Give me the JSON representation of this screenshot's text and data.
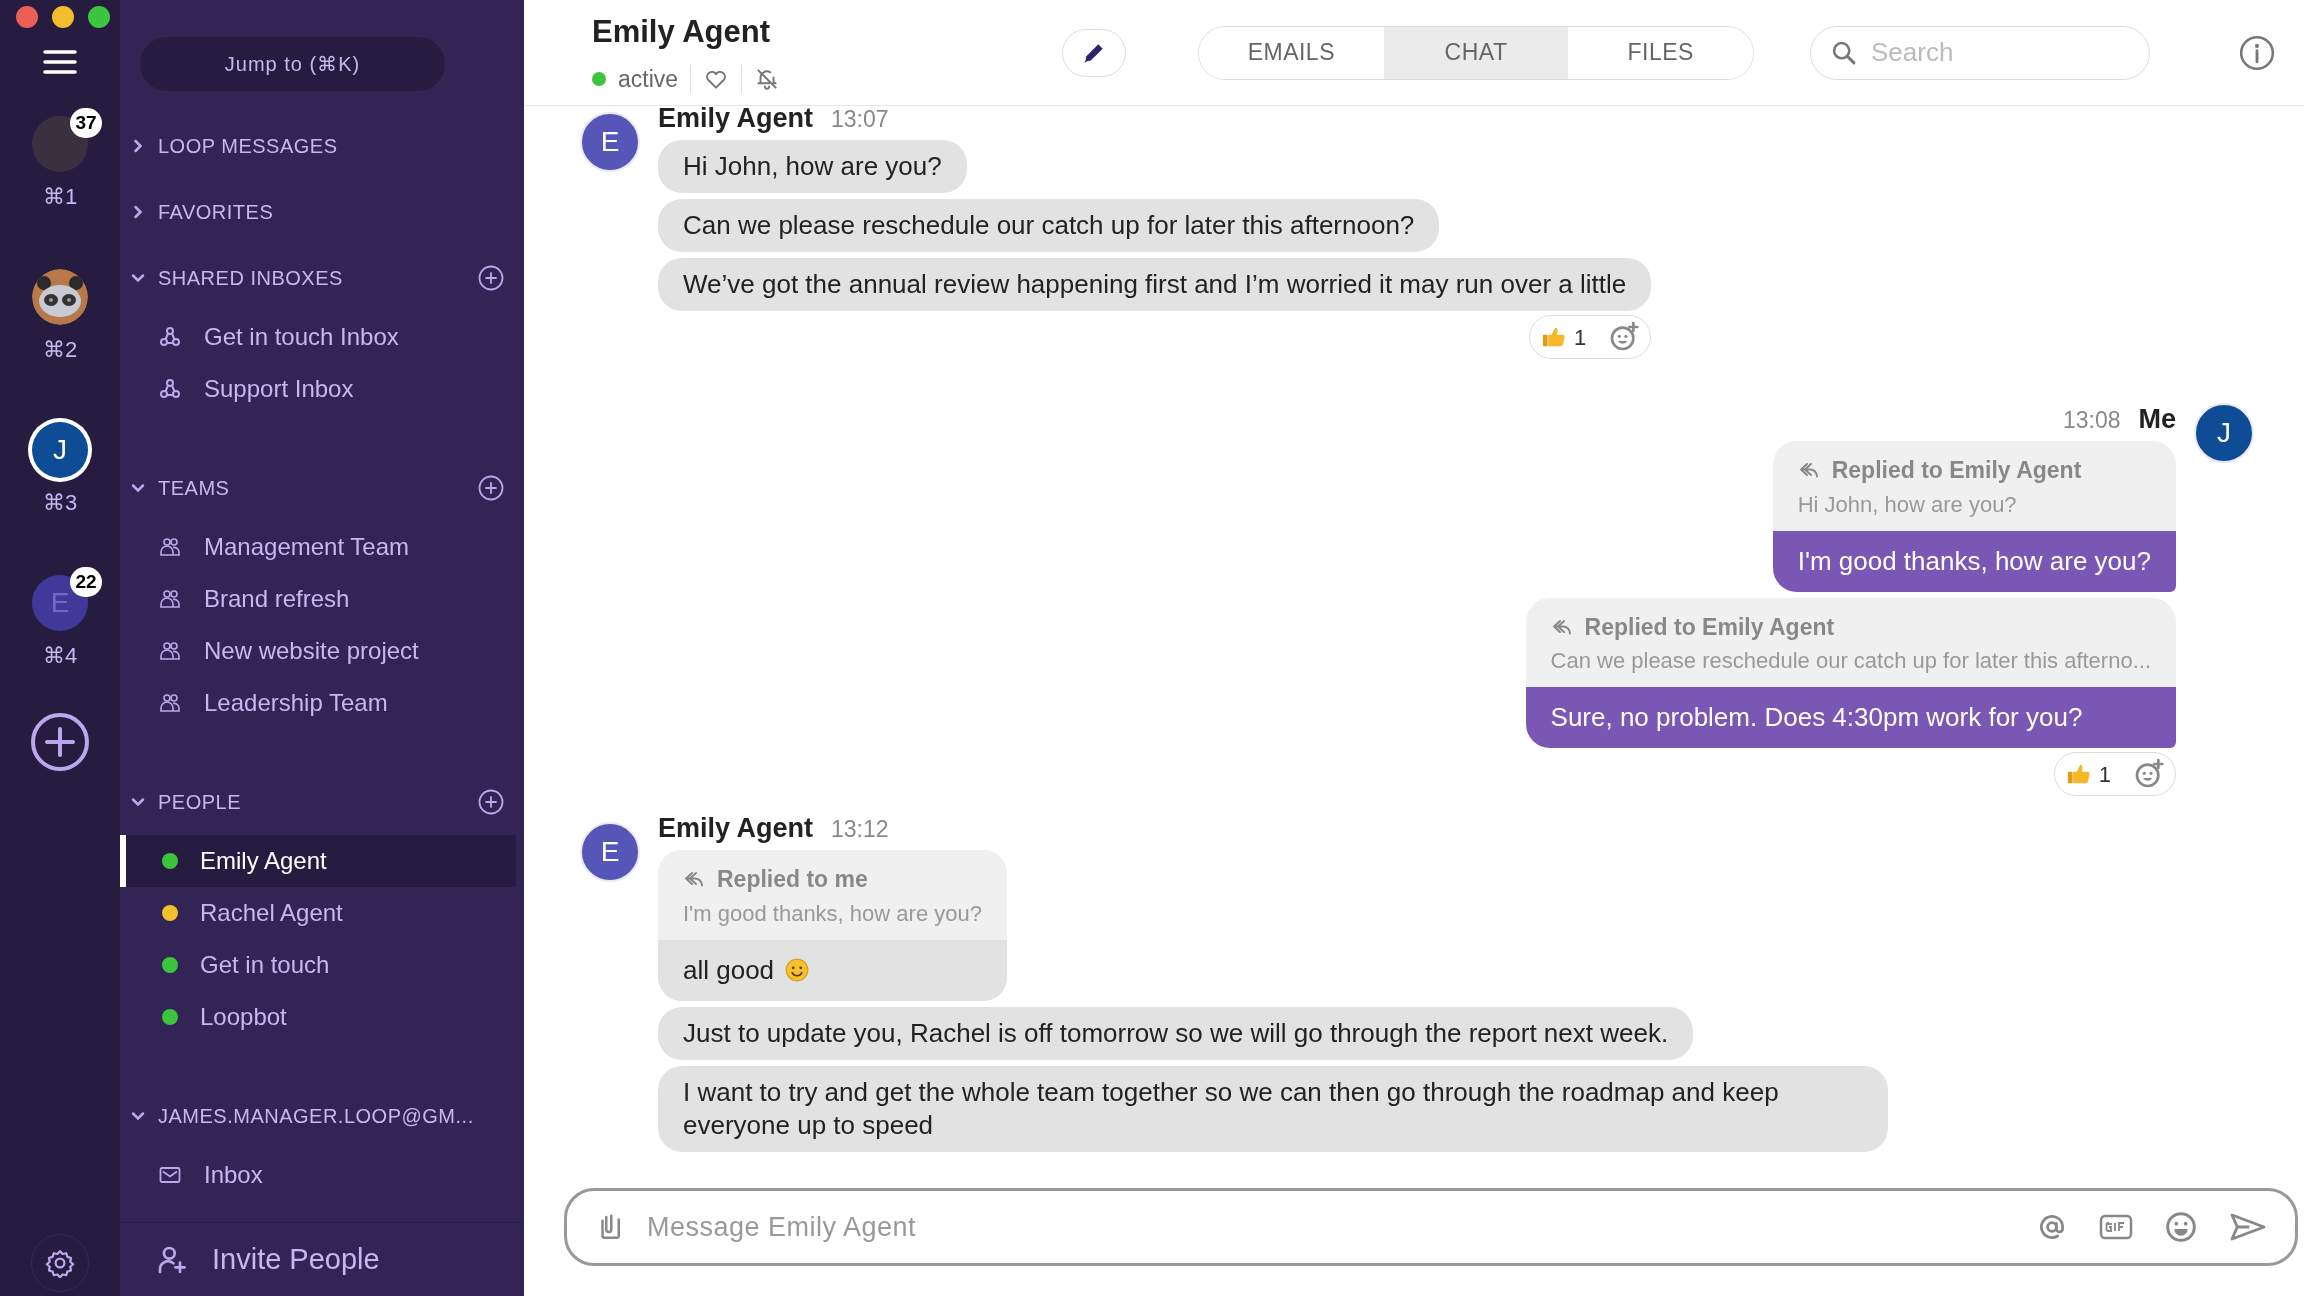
{
  "rail": {
    "workspaces": [
      {
        "kind": "photo",
        "shortcut": "⌘1",
        "badge": "37",
        "selected": false
      },
      {
        "kind": "panda",
        "shortcut": "⌘2",
        "selected": false
      },
      {
        "kind": "initial",
        "initial": "J",
        "shortcut": "⌘3",
        "selected": true
      },
      {
        "kind": "initial",
        "initial": "E",
        "shortcut": "⌘4",
        "badge": "22",
        "selected": false
      }
    ]
  },
  "sidebar": {
    "jump_button": "Jump to (⌘K)",
    "sections": [
      {
        "title": "LOOP MESSAGES",
        "expanded": false,
        "addable": false
      },
      {
        "title": "FAVORITES",
        "expanded": false,
        "addable": false
      },
      {
        "title": "SHARED INBOXES",
        "expanded": true,
        "addable": true,
        "items": [
          {
            "kind": "shared_inbox",
            "label": "Get in touch Inbox",
            "selected": false
          },
          {
            "kind": "shared_inbox",
            "label": "Support Inbox",
            "selected": false
          }
        ]
      },
      {
        "title": "TEAMS",
        "expanded": true,
        "addable": true,
        "items": [
          {
            "kind": "team",
            "label": "Management Team",
            "selected": false
          },
          {
            "kind": "team",
            "label": "Brand refresh",
            "selected": false
          },
          {
            "kind": "team",
            "label": "New website project",
            "selected": false
          },
          {
            "kind": "team",
            "label": "Leadership Team",
            "selected": false
          }
        ]
      },
      {
        "title": "PEOPLE",
        "expanded": true,
        "addable": true,
        "items": [
          {
            "kind": "person",
            "label": "Emily Agent",
            "color": "#3cc43c",
            "selected": true
          },
          {
            "kind": "person",
            "label": "Rachel Agent",
            "color": "#f2c02b",
            "selected": false
          },
          {
            "kind": "person",
            "label": "Get in touch",
            "color": "#3cc43c",
            "selected": false
          },
          {
            "kind": "person",
            "label": "Loopbot",
            "color": "#3cc43c",
            "selected": false
          }
        ]
      },
      {
        "title": "JAMES.MANAGER.LOOP@GM...",
        "expanded": true,
        "addable": false,
        "items": [
          {
            "kind": "mail",
            "label": "Inbox",
            "selected": false
          }
        ]
      }
    ],
    "invite_button": "Invite People"
  },
  "header": {
    "name": "Emily Agent",
    "status": "active",
    "tabs": [
      {
        "label": "EMAILS",
        "selected": false
      },
      {
        "label": "CHAT",
        "selected": true
      },
      {
        "label": "FILES",
        "selected": false
      }
    ],
    "search": {
      "placeholder": "Search"
    }
  },
  "messages": [
    {
      "kind": "incoming",
      "sender": "Emily Agent",
      "time": "13:07",
      "initial": "E",
      "items": [
        {
          "kind": "text",
          "text": "Hi John, how are you?"
        },
        {
          "kind": "text",
          "text": "Can we please reschedule our catch up for later this afternoon?"
        },
        {
          "kind": "text",
          "text": "We’ve got the annual review happening first and I’m worried it may run over a little",
          "reaction_count": "1"
        }
      ]
    },
    {
      "kind": "outgoing",
      "sender": "Me",
      "time": "13:08",
      "initial": "J",
      "items": [
        {
          "kind": "reply",
          "reply_label": "Replied to Emily Agent",
          "reply_quote": "Hi John, how are you?",
          "text": "I'm good thanks, how are you?"
        },
        {
          "kind": "reply",
          "reply_label": "Replied to Emily Agent",
          "reply_quote": "Can we please reschedule our catch up for later this afterno...",
          "text": "Sure, no problem. Does 4:30pm work for you?",
          "reaction_count": "1"
        }
      ]
    },
    {
      "kind": "incoming",
      "sender": "Emily Agent",
      "time": "13:12",
      "initial": "E",
      "items": [
        {
          "kind": "reply_with_smiley",
          "reply_label": "Replied to me",
          "reply_quote": "I'm good thanks, how are you?",
          "text": "all good"
        },
        {
          "kind": "text",
          "text": "Just to update you, Rachel is off tomorrow so we will go through the report next week."
        },
        {
          "kind": "text",
          "text": "I want to try and get the whole team together so we can then go through the roadmap and keep everyone up to speed"
        }
      ]
    }
  ],
  "composer": {
    "placeholder": "Message Emily Agent"
  }
}
